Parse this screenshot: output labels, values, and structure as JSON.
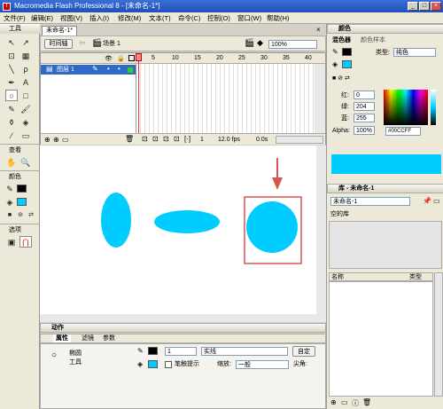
{
  "window": {
    "title": "Macromedia Flash Professional 8 - [未命名-1*]",
    "min": "_",
    "max": "□",
    "close": "×"
  },
  "menu": [
    "文件(F)",
    "编辑(E)",
    "视图(V)",
    "插入(I)",
    "修改(M)",
    "文本(T)",
    "命令(C)",
    "控制(O)",
    "窗口(W)",
    "帮助(H)"
  ],
  "toolbox": {
    "title": "工具",
    "view_label": "查看",
    "color_label": "颜色",
    "options_label": "选项"
  },
  "document": {
    "tab": "未命名-1*",
    "timeline_button": "时间轴",
    "scene": "场景 1",
    "zoom": "100%",
    "layer_name": "图层 1",
    "frame_numbers": [
      "5",
      "10",
      "15",
      "20",
      "25",
      "30",
      "35",
      "40"
    ],
    "current_frame": "1",
    "fps": "12.0 fps",
    "time": "0.0s"
  },
  "props": {
    "actions_label": "动作",
    "tabs": [
      "属性",
      "滤镜",
      "参数"
    ],
    "tool_name": "椭圆",
    "tool_sub": "工具",
    "stroke_width": "1",
    "stroke_style": "实线",
    "custom_button": "自定",
    "hinting": "笔触提示",
    "scale_label": "缩放:",
    "scale_value": "一般",
    "cap_label": "尖角:"
  },
  "color_panel": {
    "title": "颜色",
    "tabs": [
      "混色器",
      "颜色样本"
    ],
    "type_label": "类型:",
    "type_value": "纯色",
    "red_label": "红:",
    "red": "0",
    "green_label": "绿:",
    "green": "204",
    "blue_label": "蓝:",
    "blue": "255",
    "alpha_label": "Alpha:",
    "alpha": "100%",
    "hex": "#00CCFF",
    "color": "#00ccff"
  },
  "library_panel": {
    "title": "库 - 未命名-1",
    "doc_select": "未命名-1",
    "empty_text": "空的库",
    "col_name": "名称",
    "col_type": "类型"
  },
  "colors": {
    "shape_fill": "#00ccff",
    "highlight": "#d9534f"
  }
}
